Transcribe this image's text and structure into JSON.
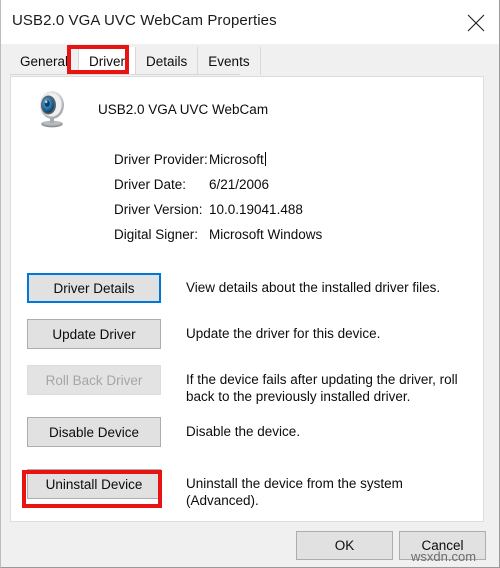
{
  "window": {
    "title": "USB2.0 VGA UVC WebCam Properties",
    "close_icon": "close-icon"
  },
  "tabs": [
    {
      "label": "General",
      "active": false
    },
    {
      "label": "Driver",
      "active": true
    },
    {
      "label": "Details",
      "active": false
    },
    {
      "label": "Events",
      "active": false
    }
  ],
  "device": {
    "icon": "webcam-icon",
    "name": "USB2.0 VGA UVC WebCam"
  },
  "driver_info": [
    {
      "label": "Driver Provider:",
      "value": "Microsoft",
      "caret": true
    },
    {
      "label": "Driver Date:",
      "value": "6/21/2006",
      "caret": false
    },
    {
      "label": "Driver Version:",
      "value": "10.0.19041.488",
      "caret": false
    },
    {
      "label": "Digital Signer:",
      "value": "Microsoft Windows",
      "caret": false
    }
  ],
  "actions": [
    {
      "button": "Driver Details",
      "description": "View details about the installed driver files.",
      "state": "focused"
    },
    {
      "button": "Update Driver",
      "description": "Update the driver for this device.",
      "state": "normal"
    },
    {
      "button": "Roll Back Driver",
      "description": "If the device fails after updating the driver, roll back to the previously installed driver.",
      "state": "disabled"
    },
    {
      "button": "Disable Device",
      "description": "Disable the device.",
      "state": "normal"
    },
    {
      "button": "Uninstall Device",
      "description": "Uninstall the device from the system (Advanced).",
      "state": "normal"
    }
  ],
  "footer": {
    "ok_label": "OK",
    "cancel_label": "Cancel"
  },
  "annotations": {
    "color": "#e81313",
    "targets": [
      "Driver",
      "Uninstall Device"
    ]
  },
  "watermark": "wsxdn.com"
}
